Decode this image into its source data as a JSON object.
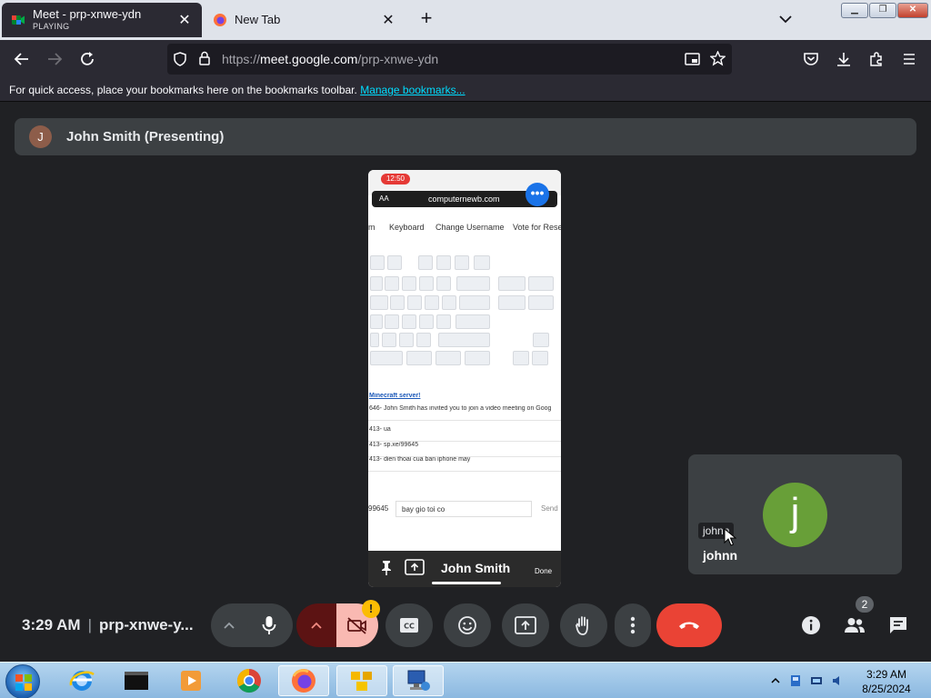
{
  "browser": {
    "tabs": [
      {
        "title": "Meet - prp-xnwe-ydn",
        "subtitle": "PLAYING",
        "active": true
      },
      {
        "title": "New Tab",
        "subtitle": "",
        "active": false
      }
    ],
    "url": {
      "scheme": "https://",
      "host": "meet.google.com",
      "path": "/prp-xnwe-ydn"
    },
    "bookmarks_text": "For quick access, place your bookmarks here on the bookmarks toolbar.",
    "bookmarks_link": "Manage bookmarks..."
  },
  "meet": {
    "presenter_initial": "J",
    "presenter_label": "John Smith (Presenting)",
    "shared_screen": {
      "status_time": "12:50",
      "address": "computernewb.com",
      "address_prefix": "AA",
      "menu": [
        "m",
        "Keyboard",
        "Change Username",
        "Vote for Reset"
      ],
      "chat_link": "Minecraft server!",
      "chat_lines": [
        "646- John Smith has invited you to join a video meeting on Goog",
        "413- ua",
        "413- sp.xe/99645",
        "413- dien thoai cua ban iphone may"
      ],
      "input_code": "99645",
      "input_text": "bay gio toi co",
      "send_label": "Send",
      "presenter_name": "John Smith",
      "done_label": "Done"
    },
    "participant": {
      "initial": "j",
      "tooltip": "johnn",
      "name": "johnn"
    },
    "time": "3:29 AM",
    "meeting_code": "prp-xnwe-y...",
    "participants_count": "2",
    "warning_symbol": "!"
  },
  "taskbar": {
    "time": "3:29 AM",
    "date": "8/25/2024"
  },
  "colors": {
    "meet_bg": "#202124",
    "tile_bg": "#3c4043",
    "end_call": "#ea4335",
    "avatar_green": "#689f38",
    "link": "#00ddff"
  }
}
